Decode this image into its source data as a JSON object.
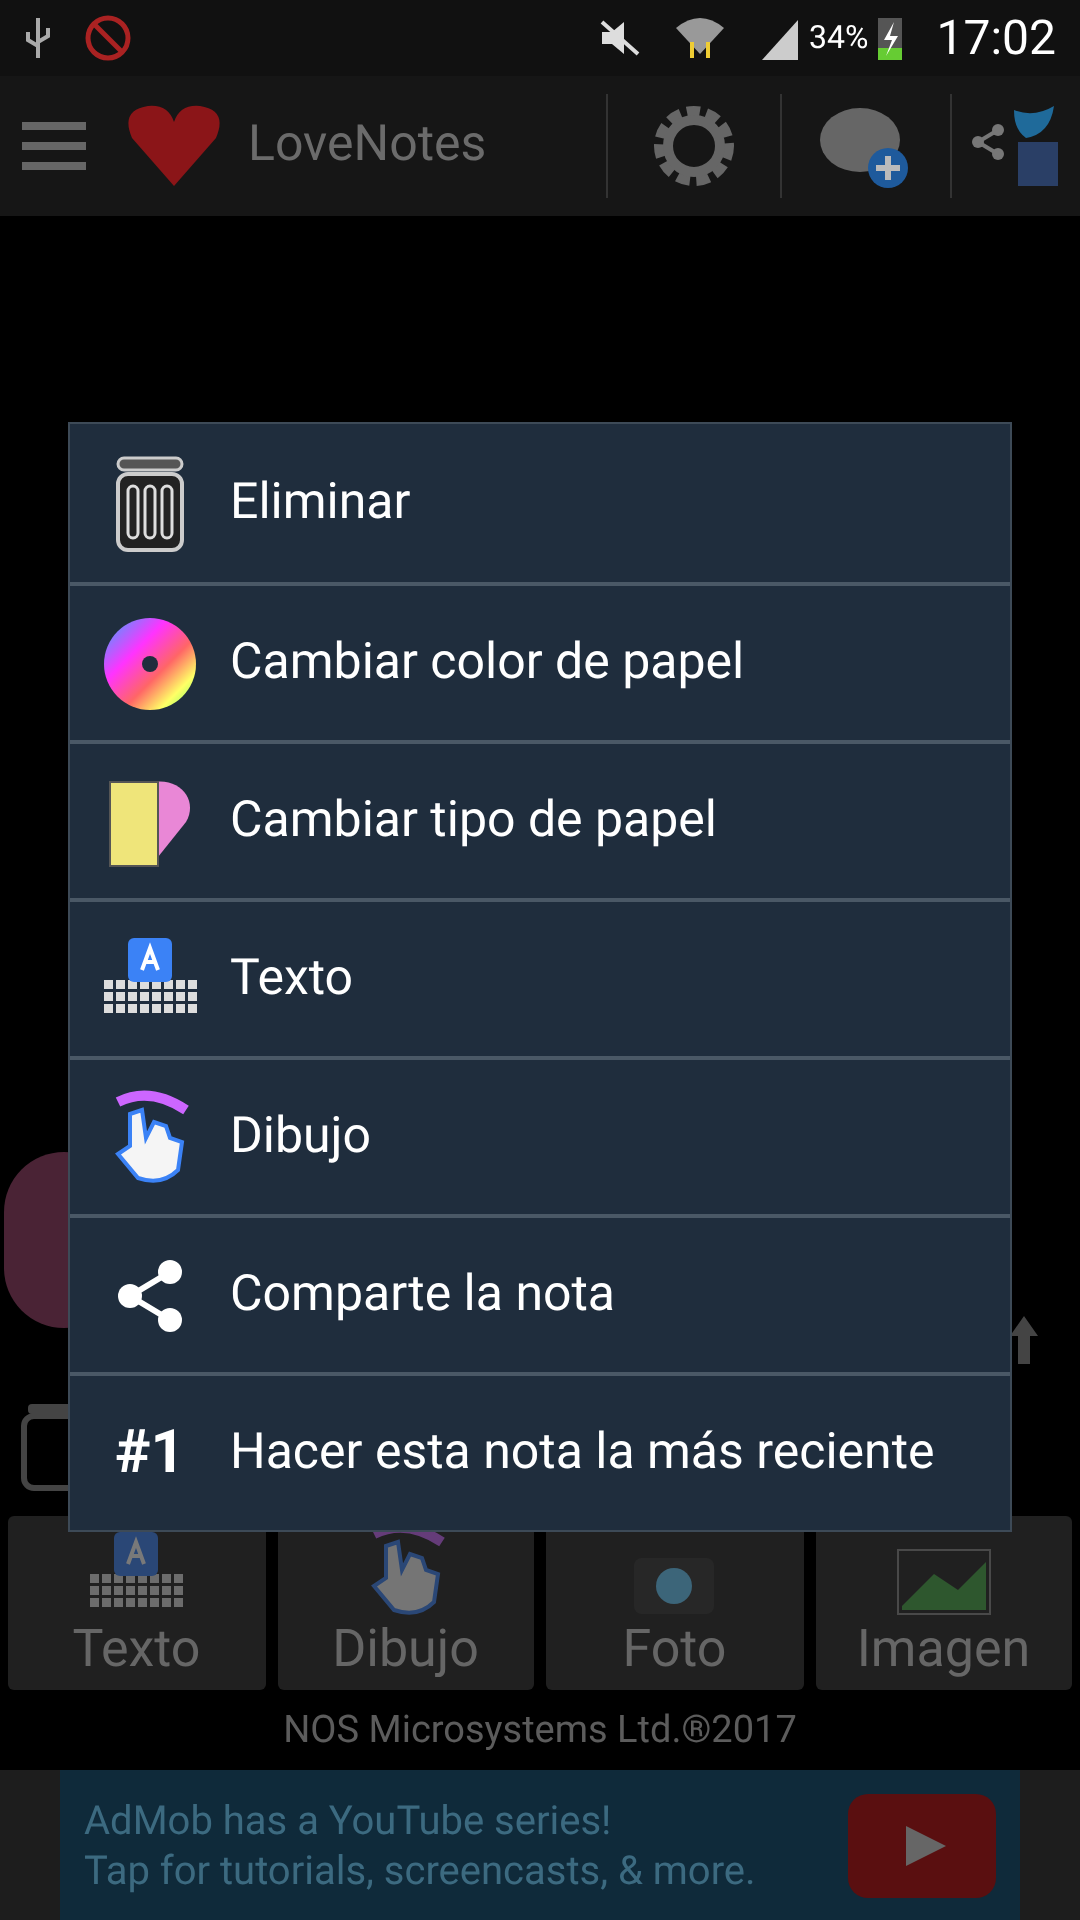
{
  "status_bar": {
    "battery": "34%",
    "time": "17:02"
  },
  "app_bar": {
    "title": "LoveNotes"
  },
  "toolbar": [
    {
      "label": "Texto",
      "kind": "keyboard"
    },
    {
      "label": "Dibujo",
      "kind": "hand"
    },
    {
      "label": "Foto",
      "kind": "camera"
    },
    {
      "label": "Imagen",
      "kind": "image"
    }
  ],
  "footer": "NOS Microsystems Ltd.®2017",
  "ad": {
    "line_1": "AdMob has a YouTube series!",
    "line_2": "Tap for tutorials, screencasts, & more."
  },
  "menu": [
    {
      "label": "Eliminar",
      "kind": "trash"
    },
    {
      "label": "Cambiar color de papel",
      "kind": "wheel"
    },
    {
      "label": "Cambiar tipo de papel",
      "kind": "paper"
    },
    {
      "label": "Texto",
      "kind": "keyboard"
    },
    {
      "label": "Dibujo",
      "kind": "hand"
    },
    {
      "label": "Comparte la nota",
      "kind": "share"
    },
    {
      "label": "Hacer esta nota la más reciente",
      "kind": "glyph",
      "glyph": "#1"
    }
  ]
}
